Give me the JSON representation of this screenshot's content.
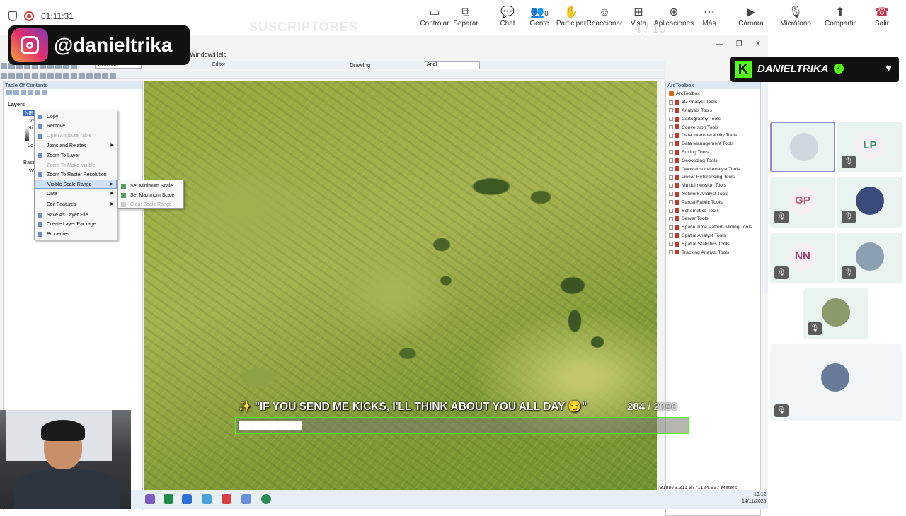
{
  "topbar": {
    "timer": "01:11:31",
    "overlay_subscribers": "SUSCRIPTORES",
    "overlay_counter": "4 / 10",
    "buttons": [
      {
        "label": "Controlar",
        "icon": "control-icon"
      },
      {
        "label": "Separar",
        "icon": "separate-icon"
      },
      {
        "label": "Chat",
        "icon": "chat-icon"
      },
      {
        "label": "Gente",
        "icon": "people-icon",
        "count": "8"
      },
      {
        "label": "Participar",
        "icon": "raise-hand-icon"
      },
      {
        "label": "Reaccionar",
        "icon": "react-icon"
      },
      {
        "label": "Vista",
        "icon": "view-icon"
      },
      {
        "label": "Aplicaciones",
        "icon": "apps-icon"
      },
      {
        "label": "Más",
        "icon": "more-icon"
      },
      {
        "label": "Cámara",
        "icon": "camera-off-icon"
      },
      {
        "label": "Micrófono",
        "icon": "mic-off-icon"
      },
      {
        "label": "Compartir",
        "icon": "share-icon"
      },
      {
        "label": "Salir",
        "icon": "hangup-icon"
      }
    ]
  },
  "instagram": {
    "handle": "@danieltrika"
  },
  "arcmap": {
    "menu_windows": "Windows",
    "menu_help": "Help",
    "scale": "1:65.752",
    "editor": "Editor",
    "drawing": "Drawing",
    "font": "Arial",
    "toc": {
      "title": "Table Of Contents",
      "layers": "Layers",
      "selected_layer": "NIR",
      "value_label": "Va",
      "high_label": "Hi",
      "low_label": "Lo",
      "basemap": "Base",
      "basemap_sub": "W"
    },
    "context_menu": [
      {
        "label": "Copy",
        "state": "normal",
        "icon": "copy-icon"
      },
      {
        "label": "Remove",
        "state": "normal",
        "icon": "remove-icon"
      },
      {
        "label": "Open Attribute Table",
        "state": "disabled",
        "icon": "table-icon"
      },
      {
        "label": "Joins and Relates",
        "state": "normal",
        "submenu": true
      },
      {
        "label": "Zoom To Layer",
        "state": "normal",
        "icon": "zoom-layer-icon"
      },
      {
        "label": "Zoom To Make Visible",
        "state": "disabled"
      },
      {
        "label": "Zoom To Raster Resolution",
        "state": "normal",
        "icon": "raster-zoom-icon"
      },
      {
        "label": "Visible Scale Range",
        "state": "highlighted",
        "submenu": true
      },
      {
        "label": "Data",
        "state": "normal",
        "submenu": true
      },
      {
        "label": "Edit Features",
        "state": "normal",
        "submenu": true
      },
      {
        "label": "Save As Layer File...",
        "state": "normal",
        "icon": "save-layer-icon"
      },
      {
        "label": "Create Layer Package...",
        "state": "normal",
        "icon": "package-icon"
      },
      {
        "label": "Properties...",
        "state": "normal",
        "icon": "properties-icon"
      }
    ],
    "submenu": [
      {
        "label": "Set Minimum Scale",
        "state": "normal"
      },
      {
        "label": "Set Maximum Scale",
        "state": "normal"
      },
      {
        "label": "Clear Scale Range",
        "state": "disabled"
      }
    ],
    "toolbox": {
      "title": "ArcToolbox",
      "root": "ArcToolbox",
      "items": [
        "3D Analyst Tools",
        "Analysis Tools",
        "Cartography Tools",
        "Conversion Tools",
        "Data Interoperability Tools",
        "Data Management Tools",
        "Editing Tools",
        "Geocoding Tools",
        "Geostatistical Analyst Tools",
        "Linear Referencing Tools",
        "Multidimension Tools",
        "Network Analyst Tools",
        "Parcel Fabric Tools",
        "Schematics Tools",
        "Server Tools",
        "Space Time Pattern Mining Tools",
        "Spatial Analyst Tools",
        "Spatial Statistics Tools",
        "Tracking Analyst Tools"
      ]
    },
    "status_coords": "318973.311  8771124.837 Meters"
  },
  "kick": {
    "goal_text": "✨ \"IF YOU SEND ME KICKS, I'LL THINK ABOUT YOU ALL DAY 😏\"",
    "count": "284",
    "max": "/ 2000",
    "progress": 0.142,
    "name": "DANIELTRIKA",
    "brand_color": "#53fc18"
  },
  "participants": [
    {
      "initials": "",
      "type": "photo",
      "muted": false
    },
    {
      "initials": "LP",
      "type": "initials",
      "color": "#3f8f6f",
      "muted": true
    },
    {
      "initials": "GP",
      "type": "initials",
      "color": "#c0607a",
      "muted": true
    },
    {
      "initials": "",
      "type": "photo",
      "muted": true
    },
    {
      "initials": "NN",
      "type": "initials",
      "color": "#a44070",
      "muted": true
    },
    {
      "initials": "",
      "type": "photo",
      "muted": true
    },
    {
      "initials": "",
      "type": "photo",
      "muted": true
    },
    {
      "initials": "",
      "type": "photo",
      "muted": true
    }
  ],
  "clock": {
    "time": "16:12",
    "date": "14/11/2025"
  }
}
